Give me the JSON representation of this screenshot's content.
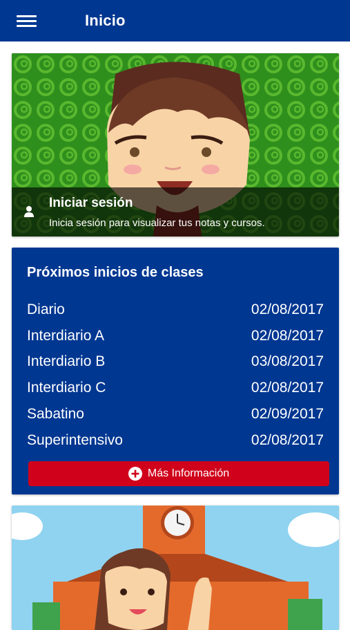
{
  "header": {
    "title": "Inicio",
    "menu_icon": "hamburger-menu-icon"
  },
  "login_card": {
    "title": "Iniciar sesión",
    "subtitle": "Inicia sesión para visualizar tus notas y cursos.",
    "icon": "person-icon"
  },
  "schedule": {
    "title": "Próximos inicios de clases",
    "rows": [
      {
        "label": "Diario",
        "date": "02/08/2017"
      },
      {
        "label": "Interdiario A",
        "date": "02/08/2017"
      },
      {
        "label": "Interdiario B",
        "date": "03/08/2017"
      },
      {
        "label": "Interdiario C",
        "date": "02/08/2017"
      },
      {
        "label": "Sabatino",
        "date": "02/09/2017"
      },
      {
        "label": "Superintensivo",
        "date": "02/08/2017"
      }
    ],
    "button_label": "Más Información",
    "button_icon": "plus-circle-icon"
  },
  "colors": {
    "primary": "#003791",
    "button": "#d0021b",
    "login_bg": "#2f8f1d"
  }
}
